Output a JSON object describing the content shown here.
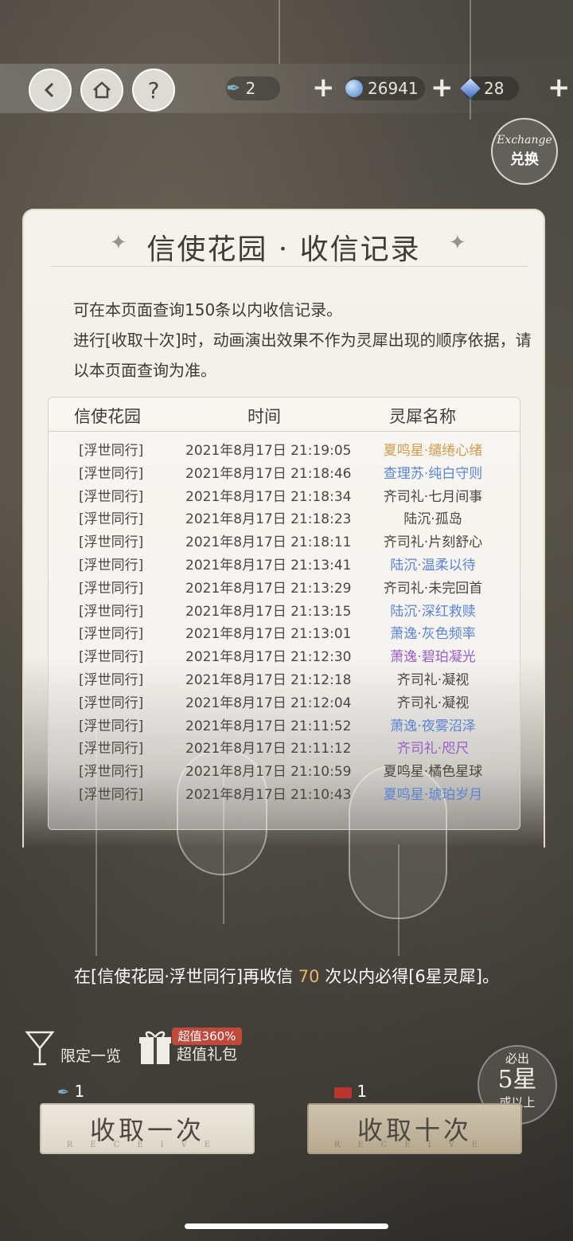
{
  "topbar": {
    "buttons": {
      "back": "back",
      "home": "home",
      "help": "?"
    },
    "resources": [
      {
        "icon": "feather-quill-icon",
        "value": "2"
      },
      {
        "icon": "blue-orb-icon",
        "value": "26941"
      },
      {
        "icon": "blue-diamond-icon",
        "value": "28"
      }
    ],
    "exchange": {
      "script": "Exchange",
      "label": "兑换"
    }
  },
  "panel": {
    "title": "信使花园 · 收信记录",
    "desc_line1": "可在本页面查询150条以内收信记录。",
    "desc_line2": "进行[收取十次]时，动画演出效果不作为灵犀出现的顺序依据，请以本页面查询为准。",
    "columns": [
      "信使花园",
      "时间",
      "灵犀名称"
    ],
    "rows": [
      {
        "garden": "[浮世同行]",
        "time": "2021年8月17日 21:19:05",
        "name": "夏鸣星·缱绻心绪",
        "color": "#d39a4e"
      },
      {
        "garden": "[浮世同行]",
        "time": "2021年8月17日 21:18:46",
        "name": "查理苏·纯白守则",
        "color": "#5b84d4"
      },
      {
        "garden": "[浮世同行]",
        "time": "2021年8月17日 21:18:34",
        "name": "齐司礼·七月间事",
        "color": "#4a4641"
      },
      {
        "garden": "[浮世同行]",
        "time": "2021年8月17日 21:18:23",
        "name": "陆沉·孤岛",
        "color": "#4a4641"
      },
      {
        "garden": "[浮世同行]",
        "time": "2021年8月17日 21:18:11",
        "name": "齐司礼·片刻舒心",
        "color": "#4a4641"
      },
      {
        "garden": "[浮世同行]",
        "time": "2021年8月17日 21:13:41",
        "name": "陆沉·温柔以待",
        "color": "#5b84d4"
      },
      {
        "garden": "[浮世同行]",
        "time": "2021年8月17日 21:13:29",
        "name": "齐司礼·未完回首",
        "color": "#4a4641"
      },
      {
        "garden": "[浮世同行]",
        "time": "2021年8月17日 21:13:15",
        "name": "陆沉·深红救赎",
        "color": "#5b84d4"
      },
      {
        "garden": "[浮世同行]",
        "time": "2021年8月17日 21:13:01",
        "name": "萧逸·灰色频率",
        "color": "#5b84d4"
      },
      {
        "garden": "[浮世同行]",
        "time": "2021年8月17日 21:12:30",
        "name": "萧逸·碧珀凝光",
        "color": "#9a5cc8"
      },
      {
        "garden": "[浮世同行]",
        "time": "2021年8月17日 21:12:18",
        "name": "齐司礼·凝视",
        "color": "#4a4641"
      },
      {
        "garden": "[浮世同行]",
        "time": "2021年8月17日 21:12:04",
        "name": "齐司礼·凝视",
        "color": "#4a4641"
      },
      {
        "garden": "[浮世同行]",
        "time": "2021年8月17日 21:11:52",
        "name": "萧逸·夜雾沼泽",
        "color": "#5b84d4"
      },
      {
        "garden": "[浮世同行]",
        "time": "2021年8月17日 21:11:12",
        "name": "齐司礼·咫尺",
        "color": "#9a5cc8"
      },
      {
        "garden": "[浮世同行]",
        "time": "2021年8月17日 21:10:59",
        "name": "夏鸣星·橘色星球",
        "color": "#4a4641"
      },
      {
        "garden": "[浮世同行]",
        "time": "2021年8月17日 21:10:43",
        "name": "夏鸣星·琥珀岁月",
        "color": "#5b84d4"
      }
    ]
  },
  "bottom": {
    "guarantee_prefix": "在[信使花园·浮世同行]再收信 ",
    "guarantee_count": "70",
    "guarantee_suffix": " 次以内必得[6星灵犀]。",
    "limited_label": "限定一览",
    "gift_badge": "超值360%",
    "gift_label": "超值礼包",
    "must_top": "必出",
    "must_main": "5星",
    "must_bottom": "或以上",
    "cost_once": "1",
    "cost_ten": "1",
    "btn_once": "收取一次",
    "btn_ten": "收取十次",
    "btn_sub": "RECEIVE"
  }
}
